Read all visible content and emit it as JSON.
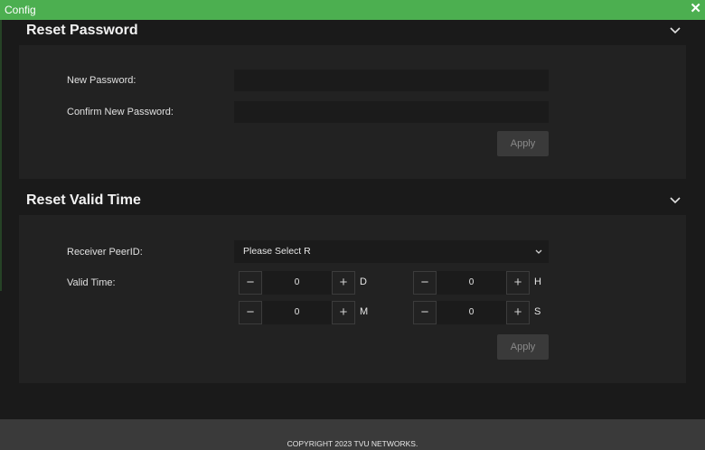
{
  "window": {
    "title": "Config",
    "close_glyph": "✕"
  },
  "reset_password": {
    "title": "Reset Password",
    "new_password_label": "New Password:",
    "new_password_value": "",
    "confirm_password_label": "Confirm New Password:",
    "confirm_password_value": "",
    "apply_label": "Apply"
  },
  "reset_valid_time": {
    "title": "Reset Valid Time",
    "receiver_label": "Receiver PeerID:",
    "receiver_selected": "Please Select R",
    "valid_time_label": "Valid Time:",
    "steppers": {
      "days": {
        "value": "0",
        "unit": "D"
      },
      "hours": {
        "value": "0",
        "unit": "H"
      },
      "minutes": {
        "value": "0",
        "unit": "M"
      },
      "seconds": {
        "value": "0",
        "unit": "S"
      }
    },
    "minus_glyph": "−",
    "plus_glyph": "+",
    "apply_label": "Apply"
  },
  "footer": {
    "copyright": "COPYRIGHT 2023 TVU NETWORKS."
  },
  "colors": {
    "titlebar": "#4caf50",
    "background": "#1a1a1a",
    "panel": "#222222",
    "footer": "#3a3a3a"
  }
}
